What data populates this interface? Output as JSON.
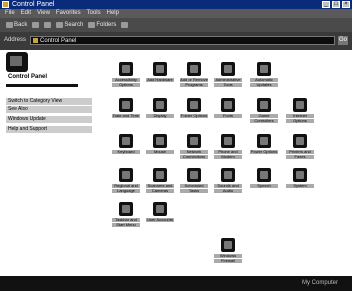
{
  "window": {
    "title": "Control Panel"
  },
  "menubar": [
    "File",
    "Edit",
    "View",
    "Favorites",
    "Tools",
    "Help"
  ],
  "toolbar": {
    "back": "Back",
    "forward": "",
    "search": "Search",
    "folders": "Folders",
    "views": ""
  },
  "address": {
    "label": "Address",
    "value": "Control Panel",
    "go": "Go"
  },
  "leftpane": {
    "title": "Control Panel",
    "links": [
      "Switch to Category View",
      "See Also",
      "Windows Update",
      "Help and Support"
    ]
  },
  "items": [
    {
      "label": "Accessibility",
      "sub": "Options"
    },
    {
      "label": "Add Hardware",
      "sub": ""
    },
    {
      "label": "Add or Remove",
      "sub": "Programs"
    },
    {
      "label": "Administrative",
      "sub": "Tools"
    },
    {
      "label": "Automatic",
      "sub": "Updates"
    },
    {
      "label": "Date and Time",
      "sub": ""
    },
    {
      "label": "Display",
      "sub": ""
    },
    {
      "label": "Folder Options",
      "sub": ""
    },
    {
      "label": "Fonts",
      "sub": ""
    },
    {
      "label": "Game",
      "sub": "Controllers"
    },
    {
      "label": "Internet",
      "sub": "Options"
    },
    {
      "label": "Keyboard",
      "sub": ""
    },
    {
      "label": "Mouse",
      "sub": ""
    },
    {
      "label": "Network",
      "sub": "Connections"
    },
    {
      "label": "Phone and",
      "sub": "Modem"
    },
    {
      "label": "Power Options",
      "sub": ""
    },
    {
      "label": "Printers and",
      "sub": "Faxes"
    },
    {
      "label": "Regional and",
      "sub": "Language"
    },
    {
      "label": "Scanners and",
      "sub": "Cameras"
    },
    {
      "label": "Scheduled",
      "sub": "Tasks"
    },
    {
      "label": "Sounds and",
      "sub": "Audio"
    },
    {
      "label": "Speech",
      "sub": ""
    },
    {
      "label": "System",
      "sub": ""
    },
    {
      "label": "Taskbar and",
      "sub": "Start Menu"
    },
    {
      "label": "User Accounts",
      "sub": ""
    },
    {
      "label": "Windows",
      "sub": "Firewall"
    }
  ],
  "status": {
    "left": "",
    "right": "My Computer"
  }
}
